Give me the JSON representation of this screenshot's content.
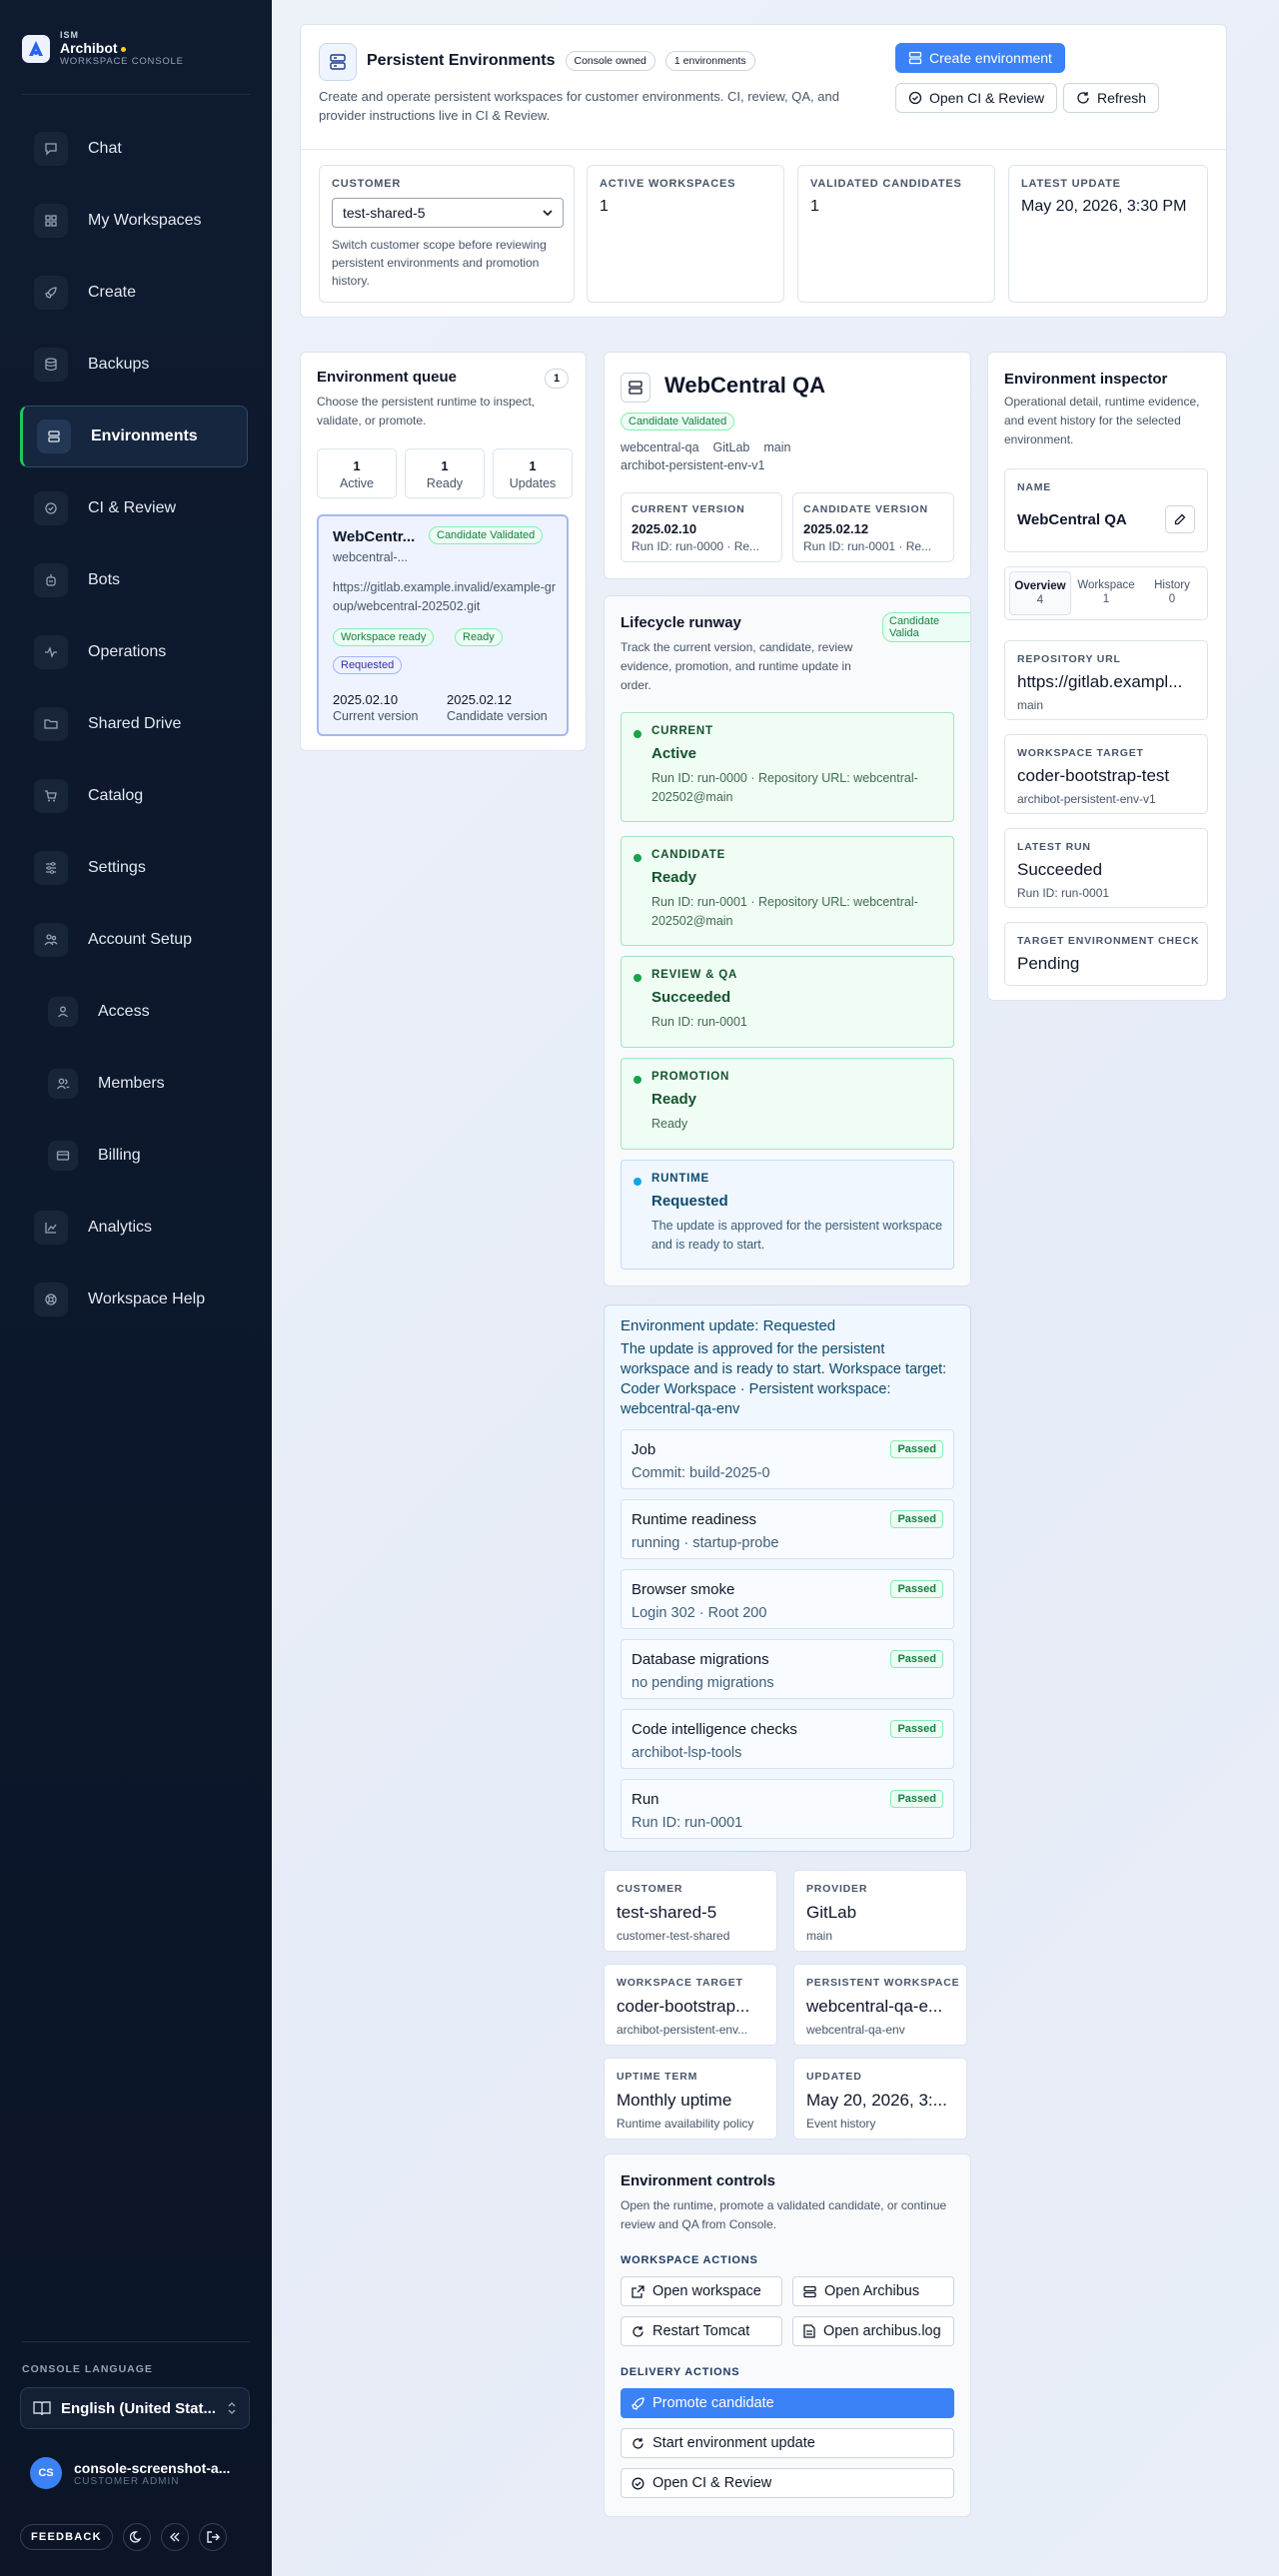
{
  "brand": {
    "kicker": "ISM",
    "name": "Archibot",
    "subtitle": "WORKSPACE CONSOLE"
  },
  "nav": [
    {
      "label": "Chat",
      "icon": "chat-icon"
    },
    {
      "label": "My Workspaces",
      "icon": "grid-icon"
    },
    {
      "label": "Create",
      "icon": "rocket-icon"
    },
    {
      "label": "Backups",
      "icon": "database-icon"
    },
    {
      "label": "Environments",
      "icon": "server-icon",
      "active": true
    },
    {
      "label": "CI & Review",
      "icon": "check-circle-icon"
    },
    {
      "label": "Bots",
      "icon": "bot-icon"
    },
    {
      "label": "Operations",
      "icon": "activity-icon"
    },
    {
      "label": "Shared Drive",
      "icon": "folder-icon"
    },
    {
      "label": "Catalog",
      "icon": "cart-icon"
    },
    {
      "label": "Settings",
      "icon": "sliders-icon"
    },
    {
      "label": "Account Setup",
      "icon": "users-icon"
    },
    {
      "label": "Access",
      "icon": "user-icon",
      "sub": true
    },
    {
      "label": "Members",
      "icon": "user-group-icon",
      "sub": true
    },
    {
      "label": "Billing",
      "icon": "card-icon",
      "sub": true
    },
    {
      "label": "Analytics",
      "icon": "chart-icon"
    },
    {
      "label": "Workspace Help",
      "icon": "lifebuoy-icon"
    }
  ],
  "sidebar_footer": {
    "language_label": "CONSOLE LANGUAGE",
    "language_value": "English (United Stat...",
    "user_initials": "CS",
    "user_name": "console-screenshot-a...",
    "user_role": "CUSTOMER ADMIN",
    "feedback_label": "FEEDBACK"
  },
  "header": {
    "title": "Persistent Environments",
    "badge_owned": "Console owned",
    "badge_count": "1 environments",
    "description": "Create and operate persistent workspaces for customer environments. CI, review, QA, and provider instructions live in CI & Review.",
    "create_button": "Create environment",
    "open_ci_button": "Open CI & Review",
    "refresh_button": "Refresh"
  },
  "summary": {
    "customer_label": "CUSTOMER",
    "customer_value": "test-shared-5",
    "customer_help": "Switch customer scope before reviewing persistent environments and promotion history.",
    "active_label": "ACTIVE WORKSPACES",
    "active_value": "1",
    "validated_label": "VALIDATED CANDIDATES",
    "validated_value": "1",
    "latest_label": "LATEST UPDATE",
    "latest_value": "May 20, 2026, 3:30 PM"
  },
  "queue": {
    "title": "Environment queue",
    "count": "1",
    "description": "Choose the persistent runtime to inspect, validate, or promote.",
    "stats": [
      {
        "value": "1",
        "label": "Active"
      },
      {
        "value": "1",
        "label": "Ready"
      },
      {
        "value": "1",
        "label": "Updates"
      }
    ],
    "item": {
      "name": "WebCentr...",
      "badge": "Candidate Validated",
      "slug": "webcentral-...",
      "url": "https://gitlab.example.invalid/example-group/webcentral-202502.git",
      "tags": [
        "Workspace ready",
        "Ready",
        "Requested"
      ],
      "current_version": "2025.02.10",
      "current_label": "Current version",
      "candidate_version": "2025.02.12",
      "candidate_label": "Candidate version"
    }
  },
  "detail": {
    "title": "WebCentral QA",
    "badge": "Candidate Validated",
    "meta": [
      "webcentral-qa",
      "GitLab",
      "main"
    ],
    "meta2": "archibot-persistent-env-v1",
    "current_version_label": "CURRENT VERSION",
    "current_version": "2025.02.10",
    "current_run": "Run ID: run-0000 · Re...",
    "candidate_version_label": "CANDIDATE VERSION",
    "candidate_version": "2025.02.12",
    "candidate_run": "Run ID: run-0001 · Re..."
  },
  "runway": {
    "title": "Lifecycle runway",
    "badge": "Candidate Valida",
    "description": "Track the current version, candidate, review evidence, promotion, and runtime update in order.",
    "stages": [
      {
        "label": "CURRENT",
        "value": "Active",
        "desc": "Run ID: run-0000 · Repository URL: webcentral-202502@main"
      },
      {
        "label": "CANDIDATE",
        "value": "Ready",
        "desc": "Run ID: run-0001 · Repository URL: webcentral-202502@main"
      },
      {
        "label": "REVIEW & QA",
        "value": "Succeeded",
        "desc": "Run ID: run-0001"
      },
      {
        "label": "PROMOTION",
        "value": "Ready",
        "desc": "Ready"
      },
      {
        "label": "RUNTIME",
        "value": "Requested",
        "desc": "The update is approved for the persistent workspace and is ready to start."
      }
    ]
  },
  "update": {
    "title": "Environment update: Requested",
    "description": "The update is approved for the persistent workspace and is ready to start. Workspace target: Coder Workspace · Persistent workspace: webcentral-qa-env",
    "checks": [
      {
        "name": "Job",
        "desc": "Commit: build-2025-0",
        "status": "Passed"
      },
      {
        "name": "Runtime readiness",
        "desc": "running · startup-probe",
        "status": "Passed"
      },
      {
        "name": "Browser smoke",
        "desc": "Login 302 · Root 200",
        "status": "Passed"
      },
      {
        "name": "Database migrations",
        "desc": "no pending migrations",
        "status": "Passed"
      },
      {
        "name": "Code intelligence checks",
        "desc": "archibot-lsp-tools",
        "status": "Passed"
      },
      {
        "name": "Run",
        "desc": "Run ID: run-0001",
        "status": "Passed"
      }
    ]
  },
  "info_grid": [
    {
      "label": "CUSTOMER",
      "value": "test-shared-5",
      "sub": "customer-test-shared"
    },
    {
      "label": "PROVIDER",
      "value": "GitLab",
      "sub": "main"
    },
    {
      "label": "WORKSPACE TARGET",
      "value": "coder-bootstrap...",
      "sub": "archibot-persistent-env..."
    },
    {
      "label": "PERSISTENT WORKSPACE",
      "value": "webcentral-qa-e...",
      "sub": "webcentral-qa-env"
    },
    {
      "label": "UPTIME TERM",
      "value": "Monthly uptime",
      "sub": "Runtime availability policy"
    },
    {
      "label": "UPDATED",
      "value": "May 20, 2026, 3:...",
      "sub": "Event history"
    }
  ],
  "controls": {
    "title": "Environment controls",
    "description": "Open the runtime, promote a validated candidate, or continue review and QA from Console.",
    "workspace_actions_label": "WORKSPACE ACTIONS",
    "open_workspace": "Open workspace",
    "open_archibus": "Open Archibus",
    "restart_tomcat": "Restart Tomcat",
    "open_log": "Open archibus.log",
    "delivery_actions_label": "DELIVERY ACTIONS",
    "promote": "Promote candidate",
    "start_update": "Start environment update",
    "open_ci": "Open CI & Review"
  },
  "inspector": {
    "title": "Environment inspector",
    "description": "Operational detail, runtime evidence, and event history for the selected environment.",
    "name_label": "NAME",
    "name_value": "WebCentral QA",
    "tabs": [
      {
        "label": "Overview",
        "count": "4"
      },
      {
        "label": "Workspace",
        "count": "1"
      },
      {
        "label": "History",
        "count": "0"
      }
    ],
    "repo_label": "REPOSITORY URL",
    "repo_value": "https://gitlab.exampl...",
    "repo_sub": "main",
    "target_label": "WORKSPACE TARGET",
    "target_value": "coder-bootstrap-test",
    "target_sub": "archibot-persistent-env-v1",
    "run_label": "LATEST RUN",
    "run_value": "Succeeded",
    "run_sub": "Run ID: run-0001",
    "check_label": "TARGET ENVIRONMENT CHECK",
    "check_value": "Pending"
  }
}
